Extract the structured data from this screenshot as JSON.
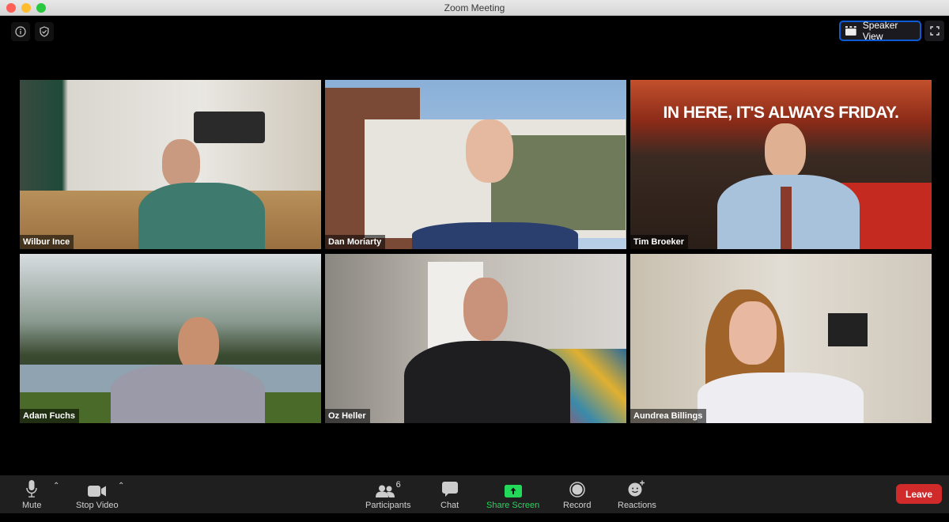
{
  "window": {
    "title": "Zoom Meeting"
  },
  "top_controls": {
    "info_icon": "info-icon",
    "security_icon": "shield-check-icon",
    "view_button_label": "Speaker View",
    "view_icon": "speaker-view-grid-icon",
    "fullscreen_icon": "fullscreen-icon"
  },
  "participants": [
    {
      "name": "Wilbur Ince"
    },
    {
      "name": "Dan Moriarty"
    },
    {
      "name": "Tim Broeker"
    },
    {
      "name": "Adam Fuchs"
    },
    {
      "name": "Oz Heller"
    },
    {
      "name": "Aundrea Billings"
    }
  ],
  "backgrounds": {
    "tim_broeker_sign": "IN HERE, IT'S ALWAYS FRIDAY."
  },
  "toolbar": {
    "mute_label": "Mute",
    "stop_video_label": "Stop Video",
    "participants_label": "Participants",
    "participants_count": "6",
    "chat_label": "Chat",
    "share_screen_label": "Share Screen",
    "record_label": "Record",
    "reactions_label": "Reactions",
    "leave_label": "Leave"
  },
  "colors": {
    "share_screen_green": "#23d959",
    "leave_red": "#d02a2a",
    "speaker_view_border": "#0e5bd6"
  }
}
